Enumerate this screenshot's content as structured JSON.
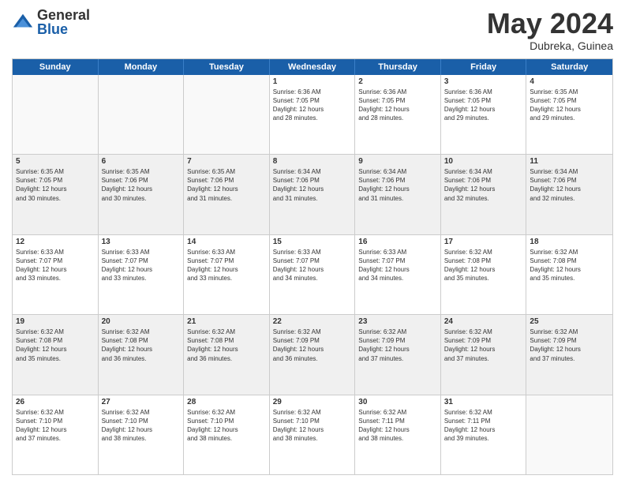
{
  "logo": {
    "general": "General",
    "blue": "Blue"
  },
  "title": "May 2024",
  "subtitle": "Dubreka, Guinea",
  "days": [
    "Sunday",
    "Monday",
    "Tuesday",
    "Wednesday",
    "Thursday",
    "Friday",
    "Saturday"
  ],
  "rows": [
    [
      {
        "num": "",
        "text": "",
        "empty": true
      },
      {
        "num": "",
        "text": "",
        "empty": true
      },
      {
        "num": "",
        "text": "",
        "empty": true
      },
      {
        "num": "1",
        "text": "Sunrise: 6:36 AM\nSunset: 7:05 PM\nDaylight: 12 hours\nand 28 minutes.",
        "empty": false
      },
      {
        "num": "2",
        "text": "Sunrise: 6:36 AM\nSunset: 7:05 PM\nDaylight: 12 hours\nand 28 minutes.",
        "empty": false
      },
      {
        "num": "3",
        "text": "Sunrise: 6:36 AM\nSunset: 7:05 PM\nDaylight: 12 hours\nand 29 minutes.",
        "empty": false
      },
      {
        "num": "4",
        "text": "Sunrise: 6:35 AM\nSunset: 7:05 PM\nDaylight: 12 hours\nand 29 minutes.",
        "empty": false
      }
    ],
    [
      {
        "num": "5",
        "text": "Sunrise: 6:35 AM\nSunset: 7:05 PM\nDaylight: 12 hours\nand 30 minutes.",
        "empty": false
      },
      {
        "num": "6",
        "text": "Sunrise: 6:35 AM\nSunset: 7:06 PM\nDaylight: 12 hours\nand 30 minutes.",
        "empty": false
      },
      {
        "num": "7",
        "text": "Sunrise: 6:35 AM\nSunset: 7:06 PM\nDaylight: 12 hours\nand 31 minutes.",
        "empty": false
      },
      {
        "num": "8",
        "text": "Sunrise: 6:34 AM\nSunset: 7:06 PM\nDaylight: 12 hours\nand 31 minutes.",
        "empty": false
      },
      {
        "num": "9",
        "text": "Sunrise: 6:34 AM\nSunset: 7:06 PM\nDaylight: 12 hours\nand 31 minutes.",
        "empty": false
      },
      {
        "num": "10",
        "text": "Sunrise: 6:34 AM\nSunset: 7:06 PM\nDaylight: 12 hours\nand 32 minutes.",
        "empty": false
      },
      {
        "num": "11",
        "text": "Sunrise: 6:34 AM\nSunset: 7:06 PM\nDaylight: 12 hours\nand 32 minutes.",
        "empty": false
      }
    ],
    [
      {
        "num": "12",
        "text": "Sunrise: 6:33 AM\nSunset: 7:07 PM\nDaylight: 12 hours\nand 33 minutes.",
        "empty": false
      },
      {
        "num": "13",
        "text": "Sunrise: 6:33 AM\nSunset: 7:07 PM\nDaylight: 12 hours\nand 33 minutes.",
        "empty": false
      },
      {
        "num": "14",
        "text": "Sunrise: 6:33 AM\nSunset: 7:07 PM\nDaylight: 12 hours\nand 33 minutes.",
        "empty": false
      },
      {
        "num": "15",
        "text": "Sunrise: 6:33 AM\nSunset: 7:07 PM\nDaylight: 12 hours\nand 34 minutes.",
        "empty": false
      },
      {
        "num": "16",
        "text": "Sunrise: 6:33 AM\nSunset: 7:07 PM\nDaylight: 12 hours\nand 34 minutes.",
        "empty": false
      },
      {
        "num": "17",
        "text": "Sunrise: 6:32 AM\nSunset: 7:08 PM\nDaylight: 12 hours\nand 35 minutes.",
        "empty": false
      },
      {
        "num": "18",
        "text": "Sunrise: 6:32 AM\nSunset: 7:08 PM\nDaylight: 12 hours\nand 35 minutes.",
        "empty": false
      }
    ],
    [
      {
        "num": "19",
        "text": "Sunrise: 6:32 AM\nSunset: 7:08 PM\nDaylight: 12 hours\nand 35 minutes.",
        "empty": false
      },
      {
        "num": "20",
        "text": "Sunrise: 6:32 AM\nSunset: 7:08 PM\nDaylight: 12 hours\nand 36 minutes.",
        "empty": false
      },
      {
        "num": "21",
        "text": "Sunrise: 6:32 AM\nSunset: 7:08 PM\nDaylight: 12 hours\nand 36 minutes.",
        "empty": false
      },
      {
        "num": "22",
        "text": "Sunrise: 6:32 AM\nSunset: 7:09 PM\nDaylight: 12 hours\nand 36 minutes.",
        "empty": false
      },
      {
        "num": "23",
        "text": "Sunrise: 6:32 AM\nSunset: 7:09 PM\nDaylight: 12 hours\nand 37 minutes.",
        "empty": false
      },
      {
        "num": "24",
        "text": "Sunrise: 6:32 AM\nSunset: 7:09 PM\nDaylight: 12 hours\nand 37 minutes.",
        "empty": false
      },
      {
        "num": "25",
        "text": "Sunrise: 6:32 AM\nSunset: 7:09 PM\nDaylight: 12 hours\nand 37 minutes.",
        "empty": false
      }
    ],
    [
      {
        "num": "26",
        "text": "Sunrise: 6:32 AM\nSunset: 7:10 PM\nDaylight: 12 hours\nand 37 minutes.",
        "empty": false
      },
      {
        "num": "27",
        "text": "Sunrise: 6:32 AM\nSunset: 7:10 PM\nDaylight: 12 hours\nand 38 minutes.",
        "empty": false
      },
      {
        "num": "28",
        "text": "Sunrise: 6:32 AM\nSunset: 7:10 PM\nDaylight: 12 hours\nand 38 minutes.",
        "empty": false
      },
      {
        "num": "29",
        "text": "Sunrise: 6:32 AM\nSunset: 7:10 PM\nDaylight: 12 hours\nand 38 minutes.",
        "empty": false
      },
      {
        "num": "30",
        "text": "Sunrise: 6:32 AM\nSunset: 7:11 PM\nDaylight: 12 hours\nand 38 minutes.",
        "empty": false
      },
      {
        "num": "31",
        "text": "Sunrise: 6:32 AM\nSunset: 7:11 PM\nDaylight: 12 hours\nand 39 minutes.",
        "empty": false
      },
      {
        "num": "",
        "text": "",
        "empty": true
      }
    ]
  ]
}
